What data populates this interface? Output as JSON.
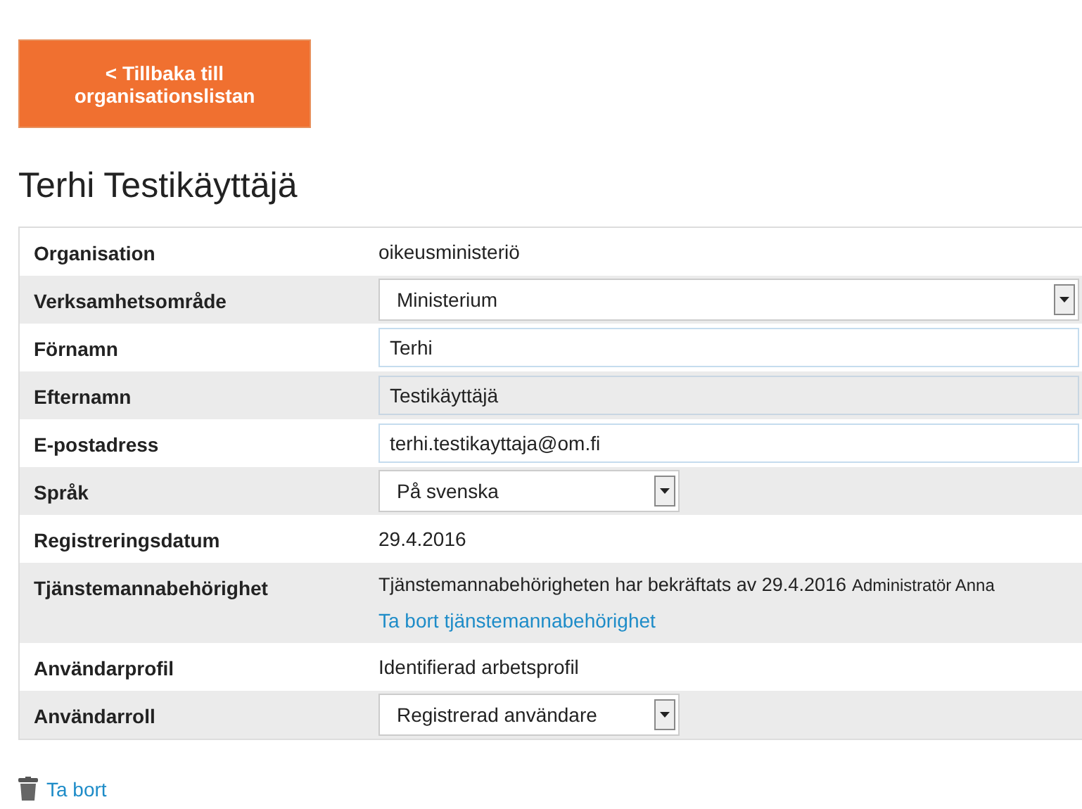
{
  "back_button": {
    "label": "< Tillbaka till organisationslistan"
  },
  "title": "Terhi Testikäyttäjä",
  "rows": [
    {
      "label": "Organisation",
      "kind": "text",
      "value": "oikeusministeriö"
    },
    {
      "label": "Verksamhetsområde",
      "kind": "select",
      "value": "Ministerium",
      "full_width": true
    },
    {
      "label": "Förnamn",
      "kind": "input",
      "value": "Terhi",
      "disabled": false
    },
    {
      "label": "Efternamn",
      "kind": "input",
      "value": "Testikäyttäjä",
      "disabled": true
    },
    {
      "label": "E-postadress",
      "kind": "input",
      "value": "terhi.testikayttaja@om.fi",
      "disabled": false
    },
    {
      "label": "Språk",
      "kind": "select",
      "value": "På svenska",
      "full_width": false
    },
    {
      "label": "Registreringsdatum",
      "kind": "text",
      "value": "29.4.2016"
    },
    {
      "label": "Tjänstemannabehörighet",
      "kind": "status",
      "value": "Tjänstemannabehörigheten har bekräftats av 29.4.2016",
      "by": "Administratör Anna",
      "link": "Ta bort tjänstemannabehörighet"
    },
    {
      "label": "Användarprofil",
      "kind": "text",
      "value": "Identifierad arbetsprofil"
    },
    {
      "label": "Användarroll",
      "kind": "select",
      "value": "Registrerad användare",
      "full_width": false
    }
  ],
  "delete_link": "Ta bort"
}
